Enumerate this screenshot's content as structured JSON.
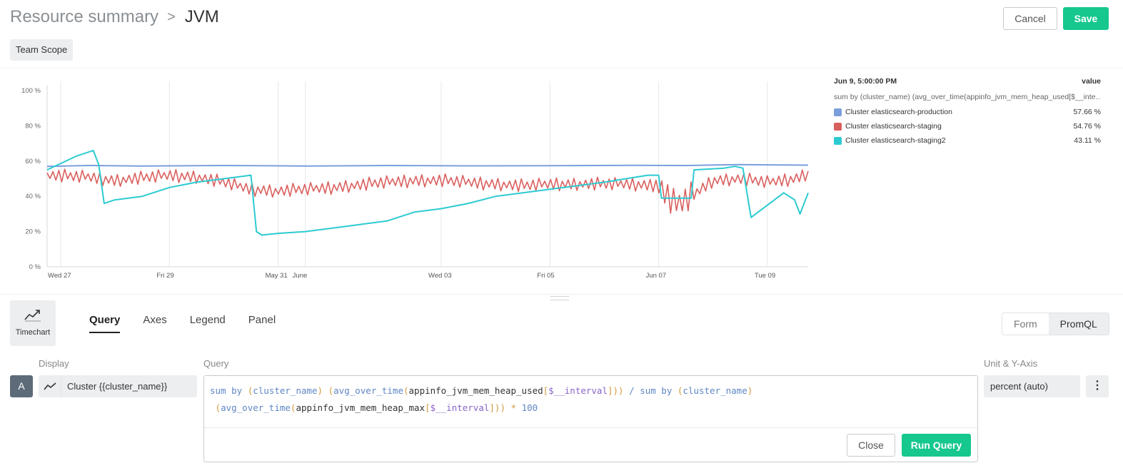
{
  "header": {
    "breadcrumb_parent": "Resource summary",
    "breadcrumb_sep": ">",
    "breadcrumb_current": "JVM",
    "scope_label": "Team Scope",
    "cancel_label": "Cancel",
    "save_label": "Save"
  },
  "legend": {
    "timestamp": "Jun 9, 5:00:00 PM",
    "value_header": "value",
    "query_label": "sum by (cluster_name) (avg_over_time(appinfo_jvm_mem_heap_used[$__inte…",
    "items": [
      {
        "name": "Cluster elasticsearch-production",
        "value": "57.66 %",
        "color": "#7b9fdc"
      },
      {
        "name": "Cluster elasticsearch-staging",
        "value": "54.76 %",
        "color": "#d9605e"
      },
      {
        "name": "Cluster elasticsearch-staging2",
        "value": "43.11 %",
        "color": "#2ccbd2"
      }
    ]
  },
  "chart_data": {
    "type": "line",
    "title": "",
    "xlabel": "",
    "ylabel": "",
    "ylim": [
      0,
      100
    ],
    "y_ticks": [
      "0 %",
      "20 %",
      "40 %",
      "60 %",
      "80 %",
      "100 %"
    ],
    "x_ticks": [
      "Wed 27",
      "Fri 29",
      "May 31",
      "June",
      "Wed 03",
      "Fri 05",
      "Jun 07",
      "Tue 09"
    ],
    "x_tick_pos": [
      0.0,
      2.0,
      4.0,
      4.5,
      7.0,
      9.0,
      11.0,
      13.0
    ],
    "x_range": [
      -0.25,
      13.75
    ],
    "grid": true,
    "series": [
      {
        "name": "Cluster elasticsearch-production",
        "color": "#7b9fdc",
        "points": [
          [
            -0.25,
            57
          ],
          [
            0.5,
            57.5
          ],
          [
            1.5,
            57.2
          ],
          [
            3,
            57.5
          ],
          [
            4.5,
            57.2
          ],
          [
            6,
            57.5
          ],
          [
            7.5,
            57.3
          ],
          [
            9,
            57.4
          ],
          [
            10.5,
            57.6
          ],
          [
            11.5,
            57.5
          ],
          [
            12.5,
            58
          ],
          [
            13.75,
            57.7
          ]
        ]
      },
      {
        "name": "Cluster elasticsearch-staging",
        "color": "#d9605e",
        "points": [
          [
            -0.25,
            52
          ],
          [
            0.5,
            51
          ],
          [
            1,
            49
          ],
          [
            2,
            52
          ],
          [
            2.5,
            51
          ],
          [
            3,
            48
          ],
          [
            3.5,
            44
          ],
          [
            4,
            43
          ],
          [
            4.5,
            44
          ],
          [
            5,
            45
          ],
          [
            6,
            48
          ],
          [
            6.5,
            49
          ],
          [
            7,
            49
          ],
          [
            7.5,
            48
          ],
          [
            8,
            47
          ],
          [
            8.5,
            46
          ],
          [
            9,
            47
          ],
          [
            9.5,
            47
          ],
          [
            10,
            47
          ],
          [
            10.5,
            47
          ],
          [
            11,
            46
          ],
          [
            11.3,
            35
          ],
          [
            11.5,
            38
          ],
          [
            12,
            49
          ],
          [
            12.5,
            50
          ],
          [
            13,
            48
          ],
          [
            13.5,
            50
          ],
          [
            13.75,
            53
          ]
        ],
        "spiky": true
      },
      {
        "name": "Cluster elasticsearch-staging2",
        "color": "#2ccbd2",
        "points": [
          [
            -0.25,
            55
          ],
          [
            0.3,
            63
          ],
          [
            0.6,
            66
          ],
          [
            0.7,
            58
          ],
          [
            0.8,
            36
          ],
          [
            1,
            38
          ],
          [
            1.5,
            40
          ],
          [
            2,
            45
          ],
          [
            2.5,
            48
          ],
          [
            3,
            50
          ],
          [
            3.5,
            52
          ],
          [
            3.6,
            20
          ],
          [
            3.7,
            18
          ],
          [
            4,
            19
          ],
          [
            4.5,
            20
          ],
          [
            5,
            22
          ],
          [
            5.5,
            24
          ],
          [
            6,
            26
          ],
          [
            6.5,
            31
          ],
          [
            7,
            33
          ],
          [
            7.5,
            36
          ],
          [
            8,
            40
          ],
          [
            9,
            44
          ],
          [
            9.5,
            46
          ],
          [
            10,
            48
          ],
          [
            10.8,
            52
          ],
          [
            11.0,
            52
          ],
          [
            11.05,
            39
          ],
          [
            11.5,
            39
          ],
          [
            11.6,
            39
          ],
          [
            11.65,
            55
          ],
          [
            12.2,
            56
          ],
          [
            12.4,
            57
          ],
          [
            12.55,
            56
          ],
          [
            12.7,
            28
          ],
          [
            13,
            35
          ],
          [
            13.3,
            42
          ],
          [
            13.5,
            38
          ],
          [
            13.6,
            30
          ],
          [
            13.75,
            42
          ]
        ]
      }
    ]
  },
  "editor": {
    "viz_label": "Timechart",
    "tabs": [
      "Query",
      "Axes",
      "Legend",
      "Panel"
    ],
    "mode_form": "Form",
    "mode_promql": "PromQL",
    "display_label": "Display",
    "query_label": "Query",
    "unit_label": "Unit & Y-Axis",
    "query_letter": "A",
    "display_value": "Cluster {{cluster_name}}",
    "unit_value": "percent (auto)",
    "close_label": "Close",
    "run_label": "Run Query",
    "query_line1": [
      {
        "t": "sum",
        "c": "kw"
      },
      {
        "t": " "
      },
      {
        "t": "by",
        "c": "kw"
      },
      {
        "t": " "
      },
      {
        "t": "(",
        "c": "fn"
      },
      {
        "t": "cluster_name",
        "c": "kw"
      },
      {
        "t": ")",
        "c": "fn"
      },
      {
        "t": " "
      },
      {
        "t": "(",
        "c": "fn"
      },
      {
        "t": "avg_over_time",
        "c": "kw"
      },
      {
        "t": "(",
        "c": "fn"
      },
      {
        "t": "appinfo_jvm_mem_heap_used"
      },
      {
        "t": "[",
        "c": "fn"
      },
      {
        "t": "$__interval",
        "c": "pr"
      },
      {
        "t": "]",
        "c": "fn"
      },
      {
        "t": "))",
        "c": "fn"
      },
      {
        "t": " "
      },
      {
        "t": "/",
        "c": "kw"
      },
      {
        "t": " "
      },
      {
        "t": "sum",
        "c": "kw"
      },
      {
        "t": " "
      },
      {
        "t": "by",
        "c": "kw"
      },
      {
        "t": " "
      },
      {
        "t": "(",
        "c": "fn"
      },
      {
        "t": "cluster_name",
        "c": "kw"
      },
      {
        "t": ")",
        "c": "fn"
      }
    ],
    "query_line2": [
      {
        "t": " "
      },
      {
        "t": "(",
        "c": "fn"
      },
      {
        "t": "avg_over_time",
        "c": "kw"
      },
      {
        "t": "(",
        "c": "fn"
      },
      {
        "t": "appinfo_jvm_mem_heap_max"
      },
      {
        "t": "[",
        "c": "fn"
      },
      {
        "t": "$__interval",
        "c": "pr"
      },
      {
        "t": "]",
        "c": "fn"
      },
      {
        "t": "))",
        "c": "fn"
      },
      {
        "t": " "
      },
      {
        "t": "*",
        "c": "fn"
      },
      {
        "t": " "
      },
      {
        "t": "100",
        "c": "kw"
      }
    ]
  }
}
